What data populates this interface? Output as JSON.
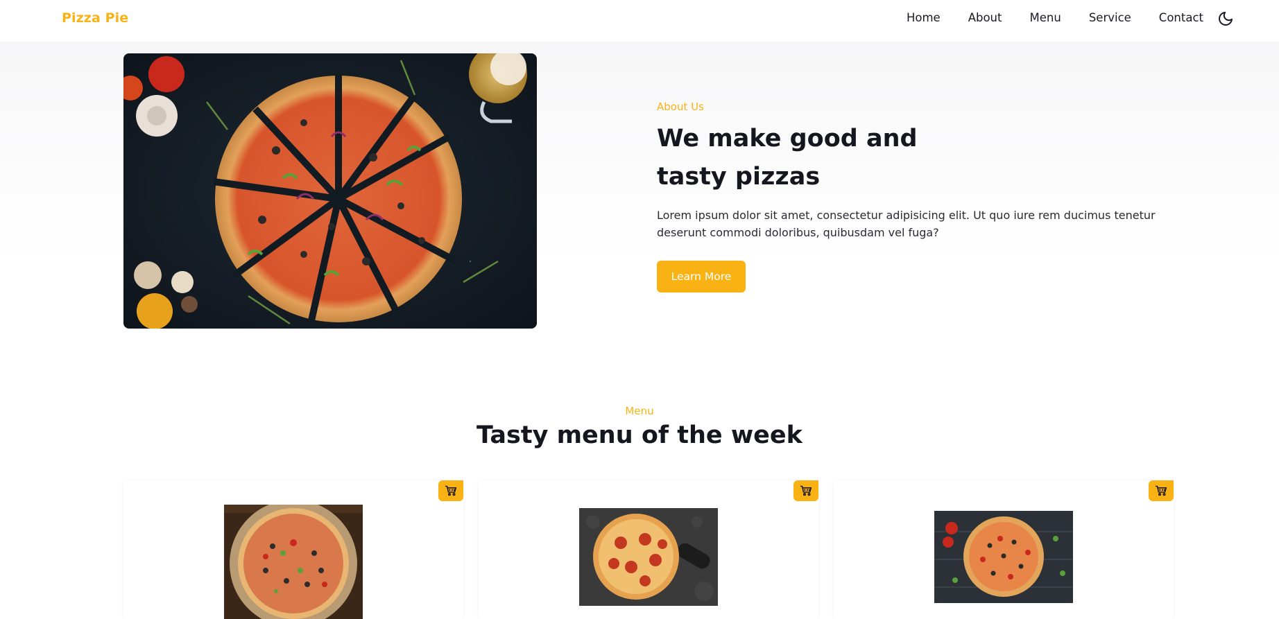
{
  "colors": {
    "accent": "#f9b214",
    "heading": "#16161f",
    "body_text": "#2a2a33",
    "background": "#ffffff"
  },
  "header": {
    "logo": "Pizza Pie",
    "nav": [
      {
        "label": "Home"
      },
      {
        "label": "About"
      },
      {
        "label": "Menu"
      },
      {
        "label": "Service"
      },
      {
        "label": "Contact"
      }
    ],
    "theme_toggle_icon": "moon-icon"
  },
  "about": {
    "subtitle": "About Us",
    "title": "We make good and tasty pizzas",
    "text": "Lorem ipsum dolor sit amet, consectetur adipisicing elit. Ut quo iure rem ducimus tenetur deserunt commodi doloribus, quibusdam vel fuga?",
    "button_label": "Learn More",
    "image": "pizza-slices-photo"
  },
  "menu": {
    "subtitle": "Menu",
    "title": "Tasty menu of the week",
    "cards": [
      {
        "image": "vegetable-pizza-photo",
        "cart_icon": "cart-icon"
      },
      {
        "image": "pepperoni-pizza-photo",
        "cart_icon": "cart-icon"
      },
      {
        "image": "supreme-pizza-photo",
        "cart_icon": "cart-icon"
      }
    ]
  }
}
